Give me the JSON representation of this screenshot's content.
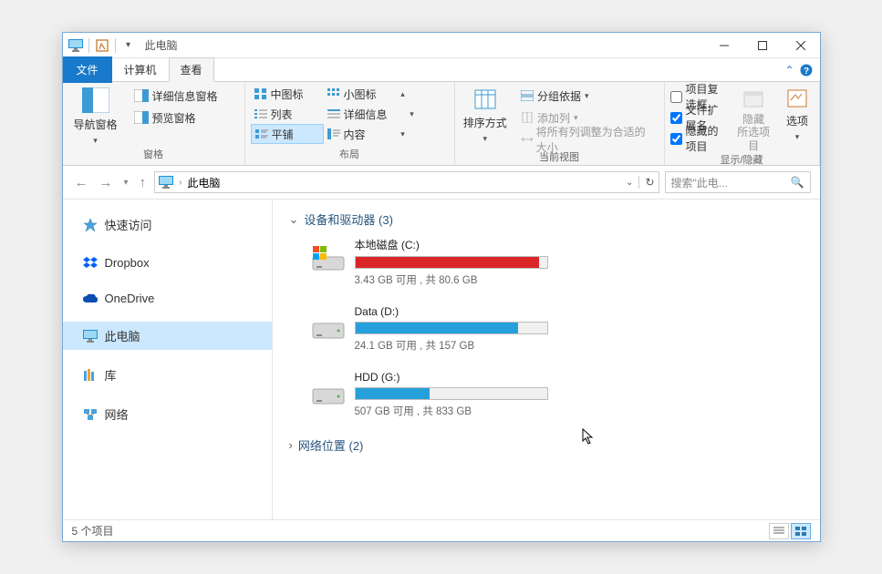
{
  "window": {
    "title": "此电脑"
  },
  "tabs": {
    "file": "文件",
    "computer": "计算机",
    "view": "查看"
  },
  "ribbon": {
    "panes": {
      "nav_pane": "导航窗格",
      "preview_pane": "预览窗格",
      "details_pane": "详细信息窗格",
      "group_label": "窗格"
    },
    "layout": {
      "medium_icons": "中图标",
      "small_icons": "小图标",
      "list": "列表",
      "details": "详细信息",
      "tiles": "平铺",
      "content": "内容",
      "group_label": "布局"
    },
    "current_view": {
      "sort_by": "排序方式",
      "group_by": "分组依据",
      "add_columns": "添加列",
      "size_all_columns": "将所有列调整为合适的大小",
      "group_label": "当前视图"
    },
    "show_hide": {
      "item_checkboxes": "项目复选框",
      "file_ext": "文件扩展名",
      "hidden_items": "隐藏的项目",
      "hide_selected": "隐藏\n所选项目",
      "options": "选项",
      "group_label": "显示/隐藏"
    }
  },
  "address": {
    "location": "此电脑",
    "search_placeholder": "搜索\"此电..."
  },
  "sidebar": {
    "quick_access": "快速访问",
    "dropbox": "Dropbox",
    "onedrive": "OneDrive",
    "this_pc": "此电脑",
    "libraries": "库",
    "network": "网络"
  },
  "sections": {
    "devices": {
      "title": "设备和驱动器",
      "count": 3
    },
    "network_locations": {
      "title": "网络位置",
      "count": 2
    }
  },
  "drives": [
    {
      "name": "本地磁盘 (C:)",
      "free": "3.43 GB",
      "total": "80.6 GB",
      "used_pct": 96,
      "color": "#da2626",
      "icon": "os"
    },
    {
      "name": "Data (D:)",
      "free": "24.1 GB",
      "total": "157 GB",
      "used_pct": 85,
      "color": "#26a0da",
      "icon": "hdd"
    },
    {
      "name": "HDD (G:)",
      "free": "507 GB",
      "total": "833 GB",
      "used_pct": 39,
      "color": "#26a0da",
      "icon": "hdd"
    }
  ],
  "status": {
    "item_count": "5 个项目"
  },
  "labels": {
    "available": "可用",
    "total_prefix": "共"
  }
}
